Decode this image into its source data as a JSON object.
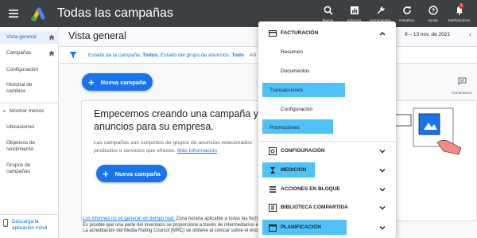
{
  "header": {
    "title": "Todas las campañas",
    "tools": [
      {
        "label": "Buscar",
        "icon": "search-icon"
      },
      {
        "label": "Informes",
        "icon": "reports-icon"
      },
      {
        "label": "Herramientas",
        "icon": "wrench-icon"
      },
      {
        "label": "Actualizar",
        "icon": "refresh-icon"
      },
      {
        "label": "Ayuda",
        "icon": "help-icon"
      },
      {
        "label": "Notificaciones",
        "icon": "bell-icon",
        "badge": "1"
      }
    ]
  },
  "sidebar": {
    "items": [
      {
        "label": "Vista general",
        "active": true,
        "home": true
      },
      {
        "label": "Campañas",
        "active": false,
        "home": true
      },
      {
        "label": "Configuración",
        "active": false
      },
      {
        "label": "Historial de cambios",
        "active": false
      },
      {
        "label": "Ubicaciones",
        "active": false
      },
      {
        "label": "Objetivos de rendimiento",
        "active": false
      },
      {
        "label": "Grupos de campañas",
        "active": false
      }
    ],
    "show_less": "Mostrar menos",
    "footer": "Descarga la aplicación móvil"
  },
  "main": {
    "page_title": "Vista general",
    "date_range": "9 – 13 nov. de 2021",
    "filter": {
      "prefix1": "Estado de la campaña: ",
      "value1": "Todos",
      "prefix2": "; Estado del grupo de anuncios: ",
      "value2": "Todo",
      "more": "Añ"
    },
    "new_campaign": "Nueva campaña",
    "comments_label": "Comentarios",
    "card": {
      "title": "Empecemos creando una campaña y grupo de anuncios para su empresa.",
      "desc_line1": "Las campañas son conjuntos de grupos de anuncios relacionados",
      "desc_line2": "productos o servicios que ofreces.",
      "link": "Más información",
      "button": "Nueva campaña"
    },
    "notice": {
      "link": "Los informes no se generan en tiempo real.",
      "line1": " Zona horaria aplicable a todas las fechas y horas:",
      "line2": "Es posible que una parte del inventario se proporcione a través de intermediarios externos.",
      "line3": "La acreditación del Media Rating Council (MRC) se obtiene al colocar sobre el encal"
    }
  },
  "menu": {
    "facturacion": "FACTURACIÓN",
    "sub": [
      "Resumen",
      "Documentos",
      "Transacciones",
      "Configuración",
      "Promociones"
    ],
    "configuracion": "CONFIGURACIÓN",
    "medicion": "MEDICIÓN",
    "acciones": "ACCIONES EN BLOQUE",
    "biblioteca": "BIBLIOTECA COMPARTIDA",
    "planificacion": "PLANIFICACIÓN"
  },
  "colors": {
    "topbar": "#3c4043",
    "accent": "#1a73e8",
    "highlight": "#4fc3f7",
    "badge": "#d93025"
  }
}
